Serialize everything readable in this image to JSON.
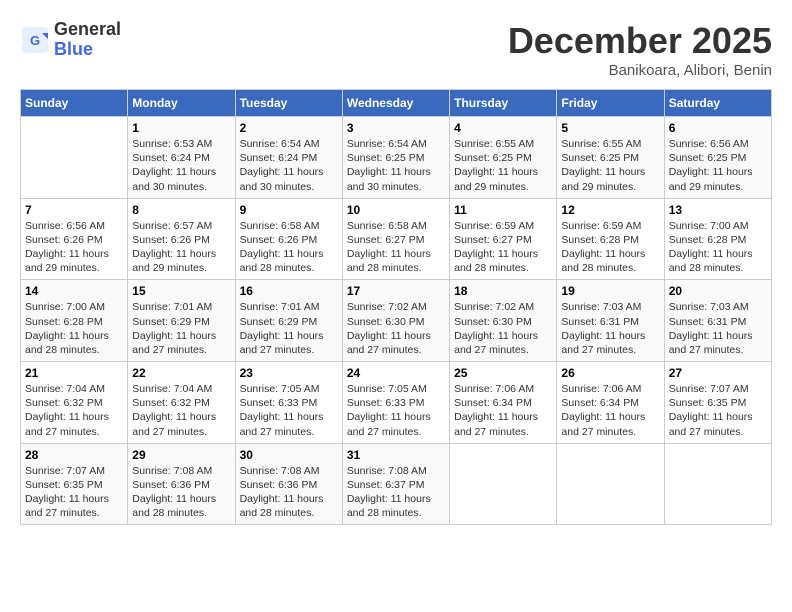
{
  "header": {
    "logo_general": "General",
    "logo_blue": "Blue",
    "month_title": "December 2025",
    "subtitle": "Banikoara, Alibori, Benin"
  },
  "days_of_week": [
    "Sunday",
    "Monday",
    "Tuesday",
    "Wednesday",
    "Thursday",
    "Friday",
    "Saturday"
  ],
  "weeks": [
    [
      {
        "day": "",
        "sunrise": "",
        "sunset": "",
        "daylight": ""
      },
      {
        "day": "1",
        "sunrise": "Sunrise: 6:53 AM",
        "sunset": "Sunset: 6:24 PM",
        "daylight": "Daylight: 11 hours and 30 minutes."
      },
      {
        "day": "2",
        "sunrise": "Sunrise: 6:54 AM",
        "sunset": "Sunset: 6:24 PM",
        "daylight": "Daylight: 11 hours and 30 minutes."
      },
      {
        "day": "3",
        "sunrise": "Sunrise: 6:54 AM",
        "sunset": "Sunset: 6:25 PM",
        "daylight": "Daylight: 11 hours and 30 minutes."
      },
      {
        "day": "4",
        "sunrise": "Sunrise: 6:55 AM",
        "sunset": "Sunset: 6:25 PM",
        "daylight": "Daylight: 11 hours and 29 minutes."
      },
      {
        "day": "5",
        "sunrise": "Sunrise: 6:55 AM",
        "sunset": "Sunset: 6:25 PM",
        "daylight": "Daylight: 11 hours and 29 minutes."
      },
      {
        "day": "6",
        "sunrise": "Sunrise: 6:56 AM",
        "sunset": "Sunset: 6:25 PM",
        "daylight": "Daylight: 11 hours and 29 minutes."
      }
    ],
    [
      {
        "day": "7",
        "sunrise": "Sunrise: 6:56 AM",
        "sunset": "Sunset: 6:26 PM",
        "daylight": "Daylight: 11 hours and 29 minutes."
      },
      {
        "day": "8",
        "sunrise": "Sunrise: 6:57 AM",
        "sunset": "Sunset: 6:26 PM",
        "daylight": "Daylight: 11 hours and 29 minutes."
      },
      {
        "day": "9",
        "sunrise": "Sunrise: 6:58 AM",
        "sunset": "Sunset: 6:26 PM",
        "daylight": "Daylight: 11 hours and 28 minutes."
      },
      {
        "day": "10",
        "sunrise": "Sunrise: 6:58 AM",
        "sunset": "Sunset: 6:27 PM",
        "daylight": "Daylight: 11 hours and 28 minutes."
      },
      {
        "day": "11",
        "sunrise": "Sunrise: 6:59 AM",
        "sunset": "Sunset: 6:27 PM",
        "daylight": "Daylight: 11 hours and 28 minutes."
      },
      {
        "day": "12",
        "sunrise": "Sunrise: 6:59 AM",
        "sunset": "Sunset: 6:28 PM",
        "daylight": "Daylight: 11 hours and 28 minutes."
      },
      {
        "day": "13",
        "sunrise": "Sunrise: 7:00 AM",
        "sunset": "Sunset: 6:28 PM",
        "daylight": "Daylight: 11 hours and 28 minutes."
      }
    ],
    [
      {
        "day": "14",
        "sunrise": "Sunrise: 7:00 AM",
        "sunset": "Sunset: 6:28 PM",
        "daylight": "Daylight: 11 hours and 28 minutes."
      },
      {
        "day": "15",
        "sunrise": "Sunrise: 7:01 AM",
        "sunset": "Sunset: 6:29 PM",
        "daylight": "Daylight: 11 hours and 27 minutes."
      },
      {
        "day": "16",
        "sunrise": "Sunrise: 7:01 AM",
        "sunset": "Sunset: 6:29 PM",
        "daylight": "Daylight: 11 hours and 27 minutes."
      },
      {
        "day": "17",
        "sunrise": "Sunrise: 7:02 AM",
        "sunset": "Sunset: 6:30 PM",
        "daylight": "Daylight: 11 hours and 27 minutes."
      },
      {
        "day": "18",
        "sunrise": "Sunrise: 7:02 AM",
        "sunset": "Sunset: 6:30 PM",
        "daylight": "Daylight: 11 hours and 27 minutes."
      },
      {
        "day": "19",
        "sunrise": "Sunrise: 7:03 AM",
        "sunset": "Sunset: 6:31 PM",
        "daylight": "Daylight: 11 hours and 27 minutes."
      },
      {
        "day": "20",
        "sunrise": "Sunrise: 7:03 AM",
        "sunset": "Sunset: 6:31 PM",
        "daylight": "Daylight: 11 hours and 27 minutes."
      }
    ],
    [
      {
        "day": "21",
        "sunrise": "Sunrise: 7:04 AM",
        "sunset": "Sunset: 6:32 PM",
        "daylight": "Daylight: 11 hours and 27 minutes."
      },
      {
        "day": "22",
        "sunrise": "Sunrise: 7:04 AM",
        "sunset": "Sunset: 6:32 PM",
        "daylight": "Daylight: 11 hours and 27 minutes."
      },
      {
        "day": "23",
        "sunrise": "Sunrise: 7:05 AM",
        "sunset": "Sunset: 6:33 PM",
        "daylight": "Daylight: 11 hours and 27 minutes."
      },
      {
        "day": "24",
        "sunrise": "Sunrise: 7:05 AM",
        "sunset": "Sunset: 6:33 PM",
        "daylight": "Daylight: 11 hours and 27 minutes."
      },
      {
        "day": "25",
        "sunrise": "Sunrise: 7:06 AM",
        "sunset": "Sunset: 6:34 PM",
        "daylight": "Daylight: 11 hours and 27 minutes."
      },
      {
        "day": "26",
        "sunrise": "Sunrise: 7:06 AM",
        "sunset": "Sunset: 6:34 PM",
        "daylight": "Daylight: 11 hours and 27 minutes."
      },
      {
        "day": "27",
        "sunrise": "Sunrise: 7:07 AM",
        "sunset": "Sunset: 6:35 PM",
        "daylight": "Daylight: 11 hours and 27 minutes."
      }
    ],
    [
      {
        "day": "28",
        "sunrise": "Sunrise: 7:07 AM",
        "sunset": "Sunset: 6:35 PM",
        "daylight": "Daylight: 11 hours and 27 minutes."
      },
      {
        "day": "29",
        "sunrise": "Sunrise: 7:08 AM",
        "sunset": "Sunset: 6:36 PM",
        "daylight": "Daylight: 11 hours and 28 minutes."
      },
      {
        "day": "30",
        "sunrise": "Sunrise: 7:08 AM",
        "sunset": "Sunset: 6:36 PM",
        "daylight": "Daylight: 11 hours and 28 minutes."
      },
      {
        "day": "31",
        "sunrise": "Sunrise: 7:08 AM",
        "sunset": "Sunset: 6:37 PM",
        "daylight": "Daylight: 11 hours and 28 minutes."
      },
      {
        "day": "",
        "sunrise": "",
        "sunset": "",
        "daylight": ""
      },
      {
        "day": "",
        "sunrise": "",
        "sunset": "",
        "daylight": ""
      },
      {
        "day": "",
        "sunrise": "",
        "sunset": "",
        "daylight": ""
      }
    ]
  ]
}
